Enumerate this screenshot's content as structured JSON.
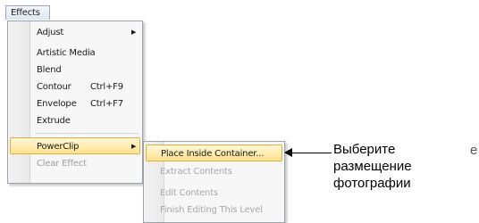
{
  "menubar": {
    "effects_label": "Effects"
  },
  "effects_menu": {
    "items": [
      {
        "label": "Adjust",
        "shortcut": "",
        "submenu": true,
        "state": "normal"
      },
      {
        "label": "Artistic Media",
        "shortcut": "",
        "submenu": false,
        "state": "normal"
      },
      {
        "label": "Blend",
        "shortcut": "",
        "submenu": false,
        "state": "normal"
      },
      {
        "label": "Contour",
        "shortcut": "Ctrl+F9",
        "submenu": false,
        "state": "normal"
      },
      {
        "label": "Envelope",
        "shortcut": "Ctrl+F7",
        "submenu": false,
        "state": "normal"
      },
      {
        "label": "Extrude",
        "shortcut": "",
        "submenu": false,
        "state": "normal"
      },
      {
        "label": "PowerClip",
        "shortcut": "",
        "submenu": true,
        "state": "selected"
      },
      {
        "label": "Clear Effect",
        "shortcut": "",
        "submenu": false,
        "state": "disabled"
      }
    ]
  },
  "powerclip_submenu": {
    "items": [
      {
        "label": "Place Inside Container...",
        "state": "selected"
      },
      {
        "label": "Extract Contents",
        "state": "disabled"
      },
      {
        "label": "Edit Contents",
        "state": "disabled"
      },
      {
        "label": "Finish Editing This Level",
        "state": "disabled"
      }
    ]
  },
  "annotation": {
    "line1": "Выберите",
    "line2": "размещение",
    "line3": "фотографии",
    "stray": "e"
  },
  "icons": {
    "submenu_arrow": "triangle-right-icon",
    "callout_arrow": "arrow-left-icon"
  }
}
